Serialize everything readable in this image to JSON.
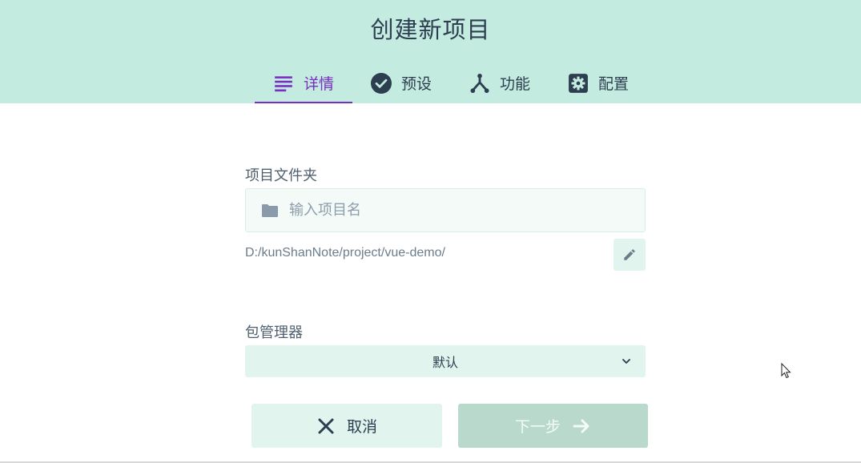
{
  "header": {
    "title": "创建新项目",
    "tabs": [
      {
        "label": "详情",
        "icon": "list-icon",
        "active": true
      },
      {
        "label": "预设",
        "icon": "check-circle-icon",
        "active": false
      },
      {
        "label": "功能",
        "icon": "merge-icon",
        "active": false
      },
      {
        "label": "配置",
        "icon": "gear-icon",
        "active": false
      }
    ]
  },
  "form": {
    "folder": {
      "label": "项目文件夹",
      "placeholder": "输入项目名",
      "value": "",
      "path": "D:/kunShanNote/project/vue-demo/"
    },
    "package_manager": {
      "label": "包管理器",
      "selected": "默认"
    }
  },
  "actions": {
    "cancel_label": "取消",
    "next_label": "下一步"
  },
  "colors": {
    "header_bg": "#c4ebe0",
    "accent": "#7a2fc4",
    "text": "#2c3e50",
    "button_bg": "#e2f4ee",
    "disabled_bg": "#b9d9cc"
  }
}
